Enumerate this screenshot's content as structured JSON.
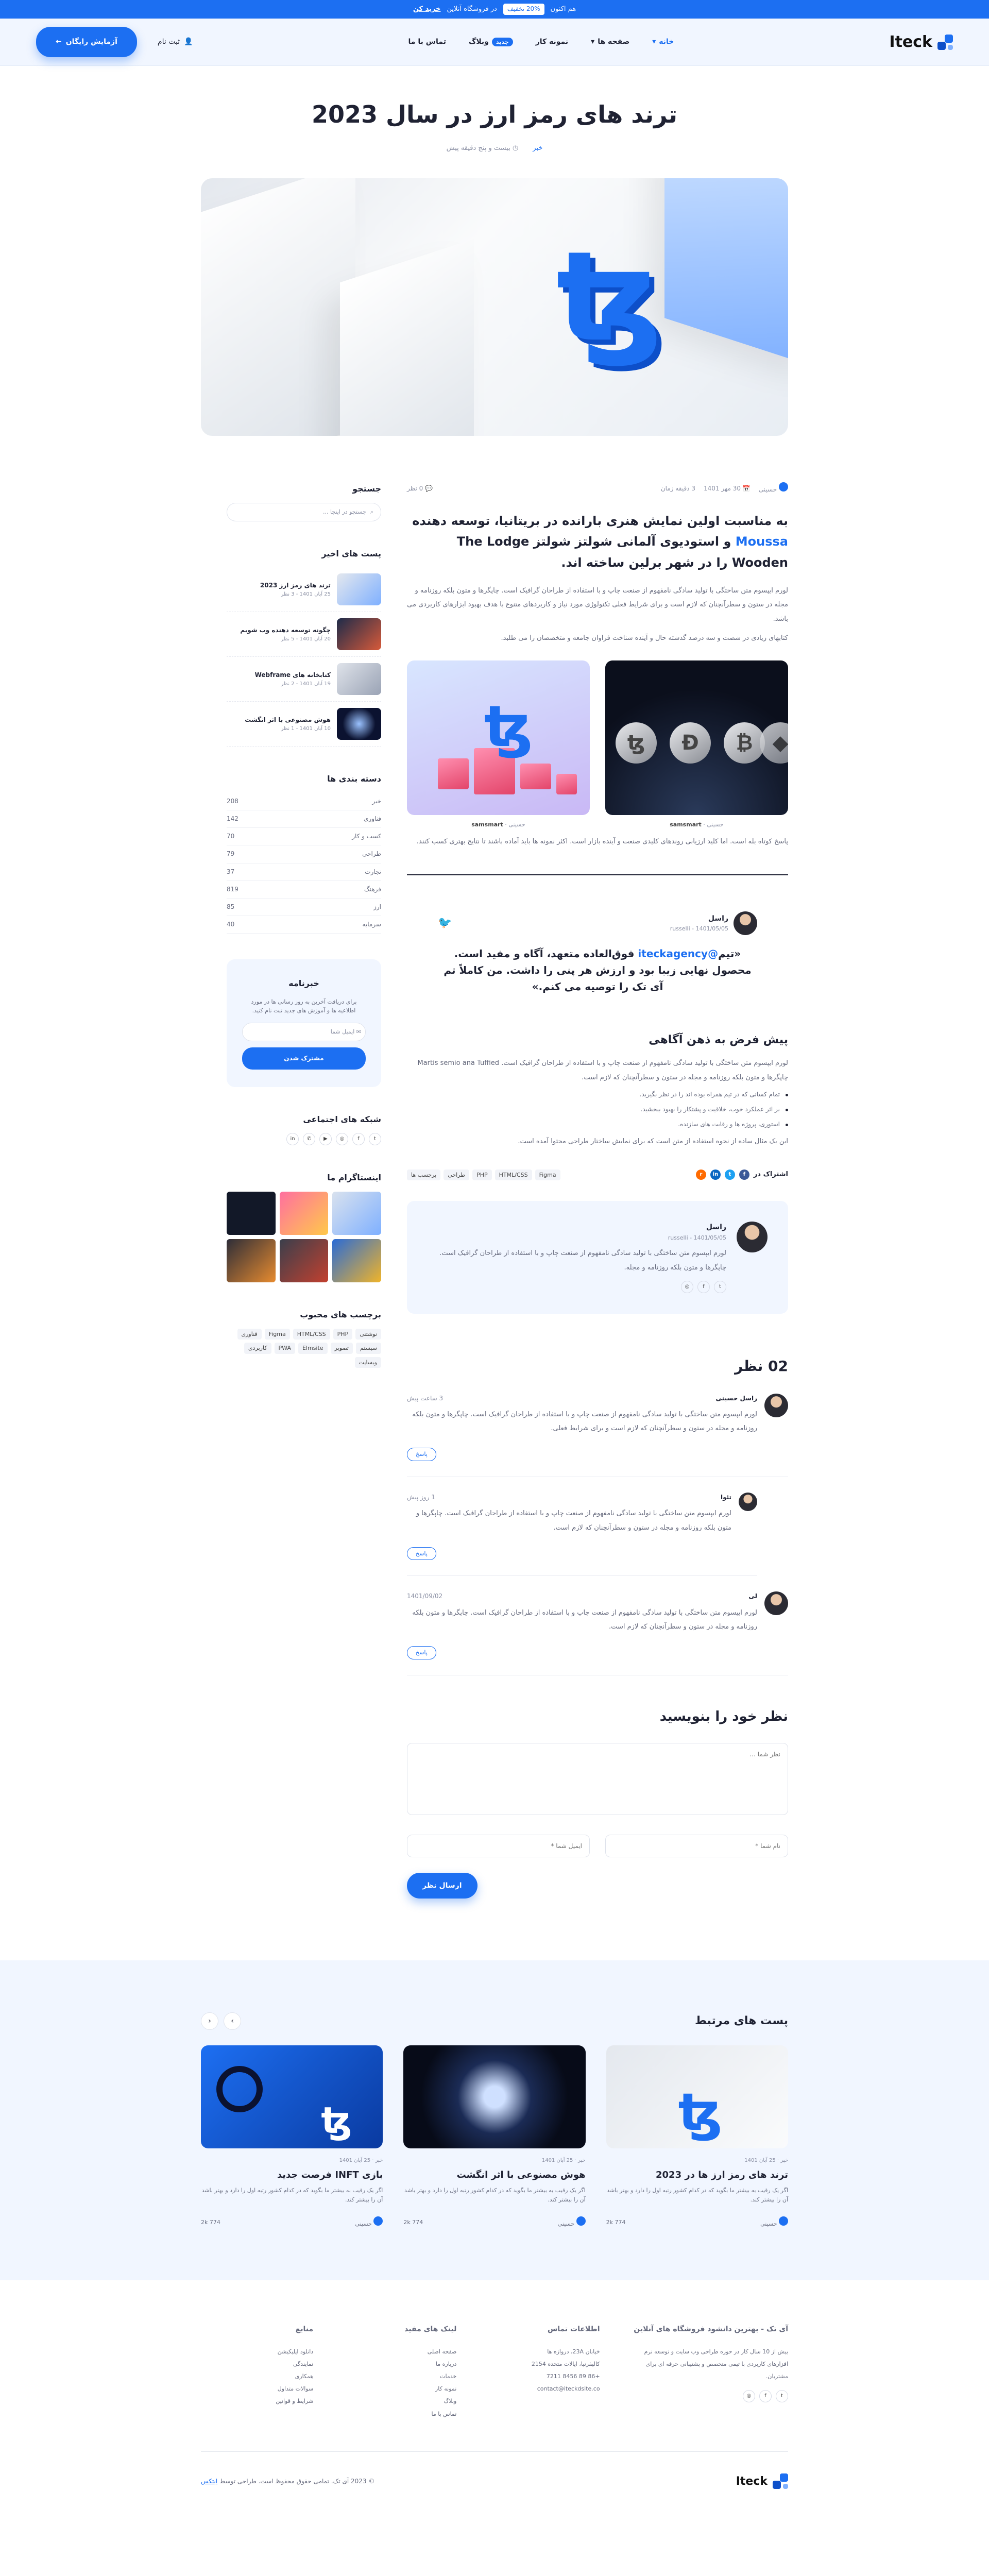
{
  "topbar": {
    "text": "هم اکنون",
    "pill": "20% تخفیف",
    "after": "در فروشگاه آنلاین",
    "link": "خرید کن"
  },
  "header": {
    "logo": "Iteck",
    "nav": [
      {
        "label": "خانه"
      },
      {
        "label": "صفحه ها"
      },
      {
        "label": "نمونه کار"
      },
      {
        "label": "وبلاگ",
        "badge": "جدید"
      },
      {
        "label": "تماس با ما"
      }
    ],
    "login": "ثبت نام",
    "cta": "آزمایش رایگان"
  },
  "post": {
    "title": "ترند های رمز ارز در سال 2023",
    "category": "خبر",
    "read_time": "بیست و پنج دقیقه پیش",
    "author": "حسینی",
    "date": "30 مهر 1401",
    "read": "3 دقیقه زمان",
    "comments_count": "0 نظر",
    "lead_a": "به مناسبت اولین نمایش هنری بارانده در بریتانیا، توسعه دهنده",
    "lead_hl": "Moussa",
    "lead_b": "و استودیوی آلمانی شولتز شولتز The Lodge Wooden را در شهر برلین ساخته اند.",
    "p1": "لورم ایپسوم متن ساختگی با تولید سادگی نامفهوم از صنعت چاپ و با استفاده از طراحان گرافیک است. چاپگرها و متون بلکه روزنامه و مجله در ستون و سطرآنچنان که لازم است و برای شرایط فعلی تکنولوژی مورد نیاز و کاربردهای متنوع با هدف بهبود ابزارهای کاربردی می باشد.",
    "p2": "کتابهای زیادی در شصت و سه درصد گذشته حال و آینده شناخت فراوان جامعه و متخصصان را می طلبد.",
    "img1_caption_a": "حسینی",
    "img1_caption_b": "samsmart",
    "img2_caption_a": "حسینی",
    "img2_caption_b": "samsmart",
    "p3": "پاسخ کوتاه بله است. اما کلید ارزیابی روندهای کلیدی صنعت و آینده بازار است. اکثر نمونه ها باید آماده باشند تا نتایج بهتری کسب کنند.",
    "quote_name": "راسل",
    "quote_handle": "russelli - 1401/05/05",
    "quote_a": "«تیم",
    "quote_hl": "@iteckagency",
    "quote_b": "فوق‌العاده متعهد، آگاه و مفید است. محصول نهایی زیبا بود و ارزش هر پنی را داشت. من کاملاً تم آی تک را توصیه می کنم.»",
    "h_prep": "پیش فرض به ذهن آگاهی",
    "p4": "لورم ایپسوم متن ساختگی با تولید سادگی نامفهوم از صنعت چاپ و با استفاده از طراحان گرافیک است. Martis semio ana Tuffied چاپگرها و متون بلکه روزنامه و مجله در ستون و سطرآنچنان که لازم است.",
    "bullets": [
      "تمام کسانی که در تیم همراه بوده اند را در نظر بگیرید.",
      "بر اثر عملکرد خوب، خلاقیت و پشتکار را بهبود ببخشید.",
      "استوری، پروژه ها و رقابت های سازنده."
    ],
    "p5": "این یک مثال ساده از نحوه استفاده از متن است که برای نمایش ساختار طراحی محتوا آمده است.",
    "tags_label": "برچسب ها",
    "tags": [
      "Figma",
      "HTML/CSS",
      "PHP",
      "طراحی"
    ],
    "share_label": "اشتراک در"
  },
  "author_box": {
    "name": "راسل",
    "handle": "russelli - 1401/05/05",
    "bio": "لورم ایپسوم متن ساختگی با تولید سادگی نامفهوم از صنعت چاپ و با استفاده از طراحان گرافیک است. چاپگرها و متون بلکه روزنامه و مجله."
  },
  "comments": {
    "title": "02 نظر",
    "items": [
      {
        "name": "راسل حسینی",
        "date": "3 ساعت پیش",
        "text": "لورم ایپسوم متن ساختگی با تولید سادگی نامفهوم از صنعت چاپ و با استفاده از طراحان گرافیک است. چاپگرها و متون بلکه روزنامه و مجله در ستون و سطرآنچنان که لازم است و برای شرایط فعلی.",
        "reply": "پاسخ"
      },
      {
        "name": "تئوا",
        "date": "1 روز پیش",
        "text": "لورم ایپسوم متن ساختگی با تولید سادگی نامفهوم از صنعت چاپ و با استفاده از طراحان گرافیک است. چاپگرها و متون بلکه روزنامه و مجله در ستون و سطرآنچنان که لازم است.",
        "reply": "پاسخ"
      },
      {
        "name": "لی",
        "date": "1401/09/02",
        "text": "لورم ایپسوم متن ساختگی با تولید سادگی نامفهوم از صنعت چاپ و با استفاده از طراحان گرافیک است. چاپگرها و متون بلکه روزنامه و مجله در ستون و سطرآنچنان که لازم است.",
        "reply": "پاسخ"
      }
    ]
  },
  "form": {
    "title": "نظر خود را بنویسید",
    "msg_ph": "نظر شما ...",
    "name_ph": "نام شما *",
    "email_ph": "ایمیل شما *",
    "submit": "ارسال نظر"
  },
  "sidebar": {
    "search_title": "جستجو",
    "search_ph": "جستجو در اینجا ...",
    "recent_title": "پست های اخیر",
    "recent": [
      {
        "t": "ترند های رمز ارز 2023",
        "d": "25 آبان 1401 - 3 نظر"
      },
      {
        "t": "چگونه توسعه دهنده وب شویم",
        "d": "20 آبان 1401 - 5 نظر"
      },
      {
        "t": "کتابخانه های Webframe",
        "d": "19 آبان 1401 - 2 نظر"
      },
      {
        "t": "هوش مصنوعی با اثر انگشت",
        "d": "10 آبان 1401 - 1 نظر"
      }
    ],
    "cats_title": "دسته بندی ها",
    "cats": [
      {
        "n": "خبر",
        "c": "208"
      },
      {
        "n": "فناوری",
        "c": "142"
      },
      {
        "n": "کسب و کار",
        "c": "70"
      },
      {
        "n": "طراحی",
        "c": "79"
      },
      {
        "n": "تجارت",
        "c": "37"
      },
      {
        "n": "فرهنگ",
        "c": "819"
      },
      {
        "n": "ارز",
        "c": "85"
      },
      {
        "n": "سرمایه",
        "c": "40"
      }
    ],
    "news_title": "خبرنامه",
    "news_text": "برای دریافت آخرین به روز رسانی ها در مورد اطلاعیه ها و آموزش های جدید ثبت نام کنید.",
    "news_ph": "ایمیل شما",
    "news_btn": "مشترک شدن",
    "social_title": "شبکه های اجتماعی",
    "insta_title": "اینستاگرام ما",
    "tags_title": "برچسب های محبوب",
    "tags": [
      "نوشتنی",
      "PHP",
      "HTML/CSS",
      "Figma",
      "فناوری",
      "سیستم",
      "تصویر",
      "Elmsite",
      "PWA",
      "کاربردی",
      "وبسایت"
    ]
  },
  "related": {
    "title": "پست های مرتبط",
    "cards": [
      {
        "meta": "خبر · 25 آبان 1401",
        "title": "ترند های رمز ارز ها در 2023",
        "desc": "اگر یک رقیب به بیشتر ما بگوید که در کدام کشور رتبه اول را دارد و بهتر باشد آن را بیشتر کند.",
        "author": "حسینی",
        "stats": "2k  774"
      },
      {
        "meta": "خبر · 25 آبان 1401",
        "title": "هوش مصنوعی با اثر انگشت",
        "desc": "اگر یک رقیب به بیشتر ما بگوید که در کدام کشور رتبه اول را دارد و بهتر باشد آن را بیشتر کند.",
        "author": "حسینی",
        "stats": "2k  774"
      },
      {
        "meta": "خبر · 25 آبان 1401",
        "title": "بازی INFT فرصت جدید",
        "desc": "اگر یک رقیب به بیشتر ما بگوید که در کدام کشور رتبه اول را دارد و بهتر باشد آن را بیشتر کند.",
        "author": "حسینی",
        "stats": "2k  774"
      }
    ]
  },
  "footer": {
    "about_title": "آی تک - بهترین دانشود فروشگاه های آنلاین",
    "about_text": "بیش از 10 سال کار در حوزه طراحی وب سایت و توسعه نرم افزارهای کاربردی با تیمی متخصص و پشتیبانی حرفه ای برای مشتریان.",
    "contact_title": "اطلاعات تماس",
    "contact": [
      "خیابان 23A، دروازه ها",
      "کالیفرنیا، ایالات متحده 2154",
      "+86 89 8456 7211",
      "contact@iteckdsite.co"
    ],
    "links_title": "لینک های مفید",
    "links": [
      "صفحه اصلی",
      "درباره ما",
      "خدمات",
      "نمونه کار",
      "وبلاگ",
      "تماس با ما"
    ],
    "res_title": "منابع",
    "res": [
      "دانلود اپلیکیشن",
      "نمایندگی",
      "همکاری",
      "سوالات متداول",
      "شرایط و قوانین"
    ],
    "copy": "© 2023 آی تک. تمامی حقوق محفوظ است. طراحی توسط",
    "copy_link": "ایتکس",
    "logo": "Iteck"
  }
}
